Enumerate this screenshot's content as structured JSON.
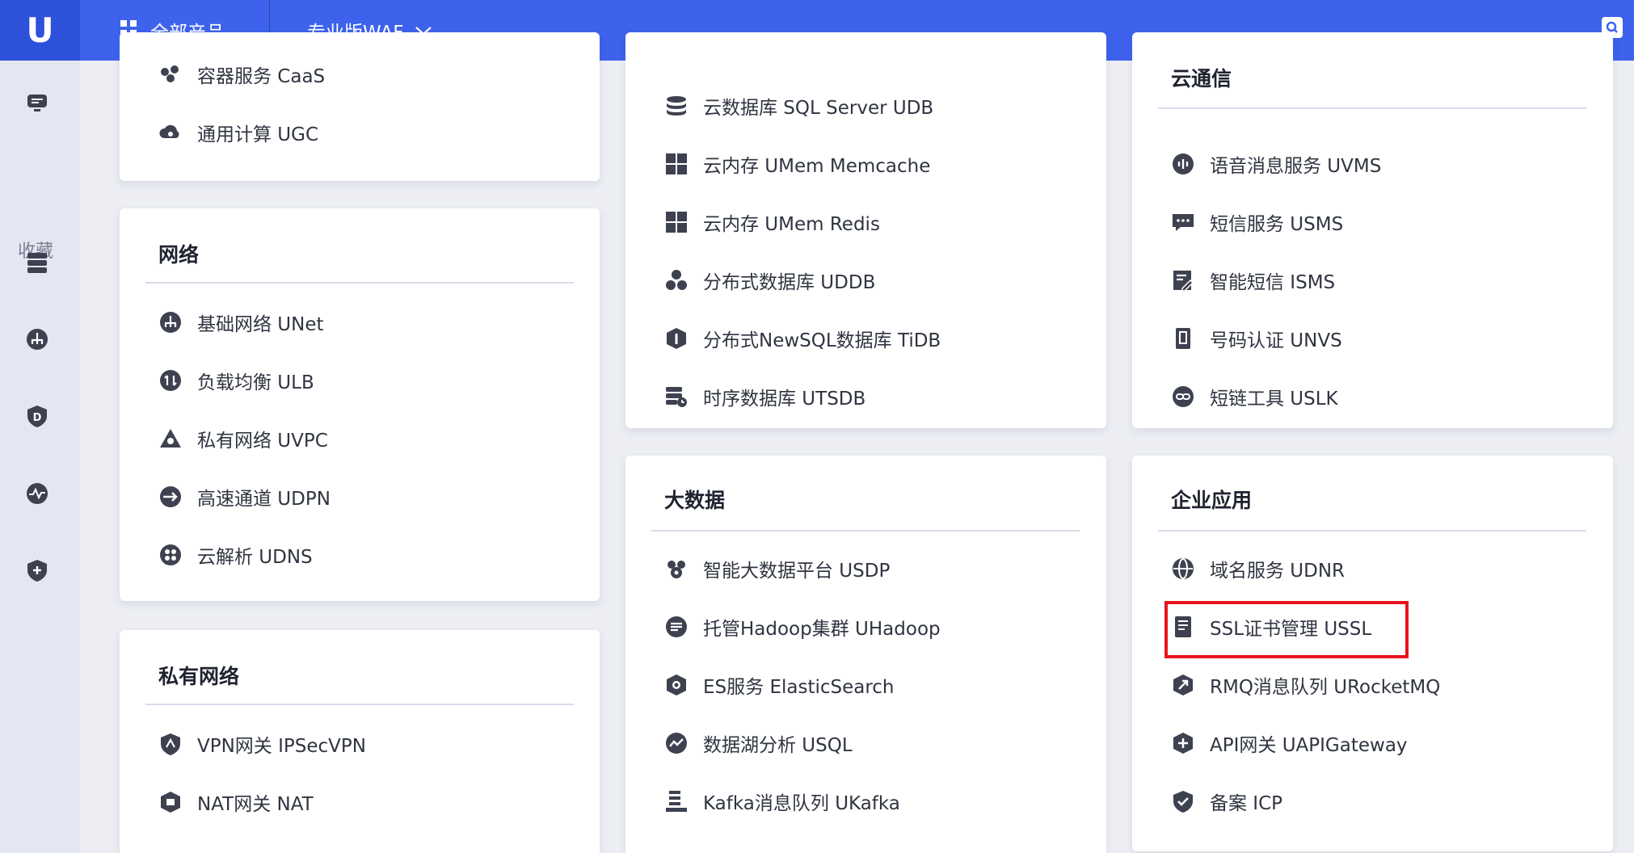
{
  "topbar": {
    "logo": "U",
    "all_products_label": "全部产品",
    "product_select_label": "专业版WAF"
  },
  "sidebar": {
    "favorites_label": "收藏"
  },
  "left_column": {
    "compute_tail": [
      {
        "label": "容器服务 CaaS",
        "icon": "container-icon"
      },
      {
        "label": "通用计算 UGC",
        "icon": "cloud-compute-icon"
      }
    ],
    "network": {
      "title": "网络",
      "items": [
        {
          "label": "基础网络 UNet",
          "icon": "network-icon"
        },
        {
          "label": "负载均衡 ULB",
          "icon": "load-balance-icon"
        },
        {
          "label": "私有网络 UVPC",
          "icon": "vpc-icon"
        },
        {
          "label": "高速通道 UDPN",
          "icon": "express-channel-icon"
        },
        {
          "label": "云解析 UDNS",
          "icon": "dns-icon"
        }
      ]
    },
    "private_network": {
      "title": "私有网络",
      "items": [
        {
          "label": "VPN网关 IPSecVPN",
          "icon": "vpn-icon"
        },
        {
          "label": "NAT网关 NAT",
          "icon": "nat-icon"
        }
      ]
    }
  },
  "middle_column": {
    "database_tail": [
      {
        "label": "云数据库 SQL Server UDB",
        "icon": "database-icon"
      },
      {
        "label": "云内存 UMem Memcache",
        "icon": "memory-grid-icon"
      },
      {
        "label": "云内存 UMem Redis",
        "icon": "memory-grid-icon"
      },
      {
        "label": "分布式数据库 UDDB",
        "icon": "distributed-db-icon"
      },
      {
        "label": "分布式NewSQL数据库 TiDB",
        "icon": "tidb-icon"
      },
      {
        "label": "时序数据库 UTSDB",
        "icon": "timeseries-db-icon"
      }
    ],
    "big_data": {
      "title": "大数据",
      "items": [
        {
          "label": "智能大数据平台 USDP",
          "icon": "bigdata-platform-icon"
        },
        {
          "label": "托管Hadoop集群 UHadoop",
          "icon": "hadoop-icon"
        },
        {
          "label": "ES服务 ElasticSearch",
          "icon": "elasticsearch-icon"
        },
        {
          "label": "数据湖分析 USQL",
          "icon": "data-lake-icon"
        },
        {
          "label": "Kafka消息队列 UKafka",
          "icon": "kafka-icon"
        }
      ]
    }
  },
  "right_column": {
    "cloud_comm": {
      "title": "云通信",
      "items": [
        {
          "label": "语音消息服务 UVMS",
          "icon": "voice-icon"
        },
        {
          "label": "短信服务 USMS",
          "icon": "sms-icon"
        },
        {
          "label": "智能短信 ISMS",
          "icon": "smart-sms-icon"
        },
        {
          "label": "号码认证 UNVS",
          "icon": "phone-verify-icon"
        },
        {
          "label": "短链工具 USLK",
          "icon": "short-link-icon"
        }
      ]
    },
    "enterprise": {
      "title": "企业应用",
      "items": [
        {
          "label": "域名服务 UDNR",
          "icon": "globe-icon"
        },
        {
          "label": "SSL证书管理 USSL",
          "icon": "certificate-icon"
        },
        {
          "label": "RMQ消息队列 URocketMQ",
          "icon": "rocketmq-icon"
        },
        {
          "label": "API网关 UAPIGateway",
          "icon": "api-gateway-icon"
        },
        {
          "label": "备案 ICP",
          "icon": "icp-shield-icon"
        }
      ]
    }
  },
  "colors": {
    "topbar": "#3e62ec",
    "logo_bg": "#2d51da",
    "highlight": "#e8141d",
    "icon": "#3d4150"
  }
}
